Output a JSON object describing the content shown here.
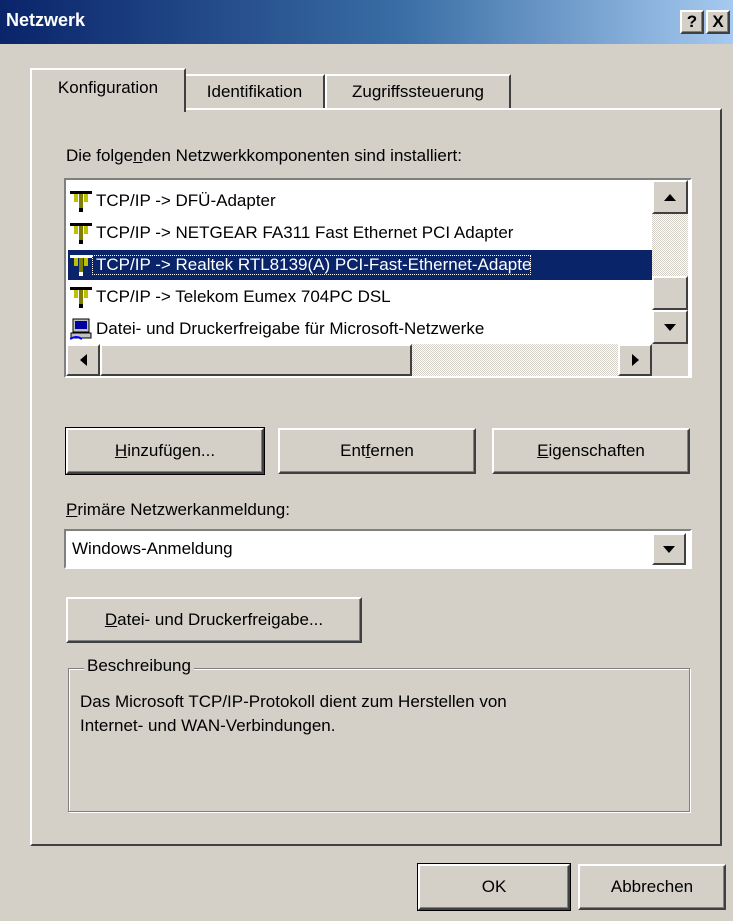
{
  "window": {
    "title": "Netzwerk",
    "help_button": "?",
    "close_button": "X"
  },
  "tabs": [
    {
      "label": "Konfiguration",
      "active": true
    },
    {
      "label": "Identifikation",
      "active": false
    },
    {
      "label": "Zugriffssteuerung",
      "active": false
    }
  ],
  "components": {
    "label_pre": "Die folge",
    "label_ul": "n",
    "label_post": "den Netzwerkkomponenten sind installiert:",
    "items": [
      {
        "text": "TCP/IP -> DFÜ-Adapter",
        "icon": "network-cable-icon",
        "selected": false
      },
      {
        "text": "TCP/IP -> NETGEAR FA311 Fast Ethernet PCI Adapter",
        "icon": "network-cable-icon",
        "selected": false
      },
      {
        "text": "TCP/IP -> Realtek RTL8139(A) PCI-Fast-Ethernet-Adapte",
        "icon": "network-cable-icon",
        "selected": true
      },
      {
        "text": "TCP/IP -> Telekom Eumex 704PC DSL",
        "icon": "network-cable-icon",
        "selected": false
      },
      {
        "text": "Datei- und Druckerfreigabe für Microsoft-Netzwerke",
        "icon": "computer-share-icon",
        "selected": false
      }
    ]
  },
  "buttons": {
    "add": {
      "ul": "H",
      "rest": "inzufügen..."
    },
    "remove": {
      "pre": "Ent",
      "ul": "f",
      "rest": "ernen"
    },
    "properties": {
      "ul": "E",
      "rest": "igenschaften"
    },
    "file_print": {
      "ul": "D",
      "rest": "atei- und Druckerfreigabe..."
    },
    "ok": "OK",
    "cancel": "Abbrechen"
  },
  "logon": {
    "label_ul": "P",
    "label_rest": "rimäre Netzwerkanmeldung:",
    "selected": "Windows-Anmeldung"
  },
  "description": {
    "legend": "Beschreibung",
    "text_line1": "Das Microsoft TCP/IP-Protokoll dient zum Herstellen von",
    "text_line2": "Internet- und WAN-Verbindungen."
  },
  "colors": {
    "face": "#d4d0c8",
    "selection": "#0a246a",
    "title_start": "#0a246a",
    "title_end": "#a6caf0"
  }
}
